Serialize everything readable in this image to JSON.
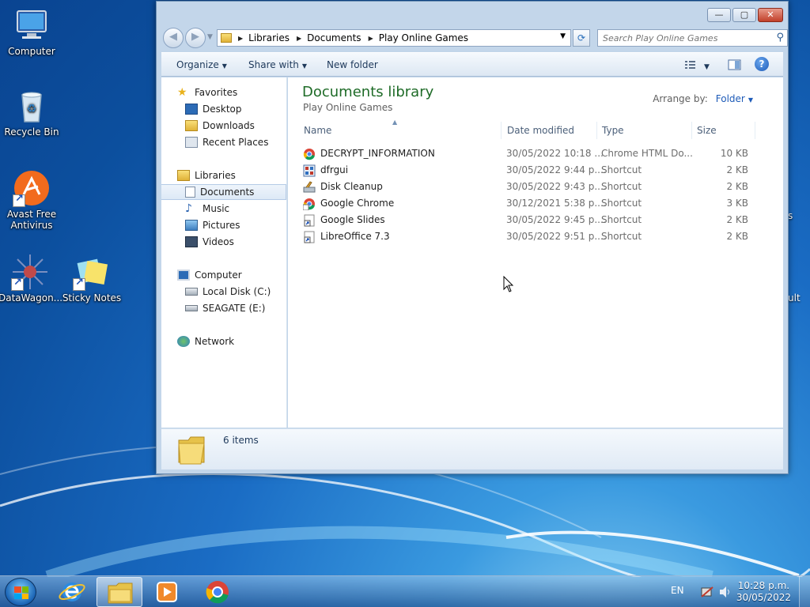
{
  "desktop": {
    "icons": [
      {
        "label": "Computer",
        "icon": "computer-icon"
      },
      {
        "label": "Recycle Bin",
        "icon": "recycle-bin-icon"
      },
      {
        "label": "Avast Free Antivirus",
        "icon": "avast-icon"
      },
      {
        "label": "DataWagon...",
        "icon": "datawagon-icon"
      },
      {
        "label": "Sticky Notes",
        "icon": "sticky-notes-icon"
      }
    ],
    "edge_labels": [
      "s",
      "ult"
    ]
  },
  "window": {
    "controls": {
      "minimize": "—",
      "maximize": "▢",
      "close": "✕"
    },
    "address": {
      "crumbs": [
        "Libraries",
        "Documents",
        "Play Online Games"
      ]
    },
    "search": {
      "placeholder": "Search Play Online Games"
    },
    "toolbar": {
      "organize": "Organize",
      "share_with": "Share with",
      "new_folder": "New folder",
      "help": "?"
    },
    "nav": {
      "favorites": "Favorites",
      "desktop": "Desktop",
      "downloads": "Downloads",
      "recent_places": "Recent Places",
      "libraries": "Libraries",
      "documents": "Documents",
      "music": "Music",
      "pictures": "Pictures",
      "videos": "Videos",
      "computer": "Computer",
      "local_disk": "Local Disk (C:)",
      "seagate": "SEAGATE (E:)",
      "network": "Network"
    },
    "main": {
      "title": "Documents library",
      "subtitle": "Play Online Games",
      "arrange_label": "Arrange by:",
      "arrange_value": "Folder",
      "columns": {
        "name": "Name",
        "date": "Date modified",
        "type": "Type",
        "size": "Size"
      },
      "files": [
        {
          "name": "DECRYPT_INFORMATION",
          "date": "30/05/2022 10:18 ...",
          "type": "Chrome HTML Do...",
          "size": "10 KB",
          "icon": "chrome-icon"
        },
        {
          "name": "dfrgui",
          "date": "30/05/2022 9:44 p....",
          "type": "Shortcut",
          "size": "2 KB",
          "icon": "defrag-icon"
        },
        {
          "name": "Disk Cleanup",
          "date": "30/05/2022 9:43 p....",
          "type": "Shortcut",
          "size": "2 KB",
          "icon": "disk-cleanup-icon"
        },
        {
          "name": "Google Chrome",
          "date": "30/12/2021 5:38 p....",
          "type": "Shortcut",
          "size": "3 KB",
          "icon": "chrome-shortcut-icon"
        },
        {
          "name": "Google Slides",
          "date": "30/05/2022 9:45 p....",
          "type": "Shortcut",
          "size": "2 KB",
          "icon": "shortcut-icon"
        },
        {
          "name": "LibreOffice 7.3",
          "date": "30/05/2022 9:51 p....",
          "type": "Shortcut",
          "size": "2 KB",
          "icon": "shortcut-icon"
        }
      ]
    },
    "details": {
      "count": "6 items"
    }
  },
  "taskbar": {
    "language": "EN",
    "time": "10:28 p.m.",
    "date": "30/05/2022"
  }
}
